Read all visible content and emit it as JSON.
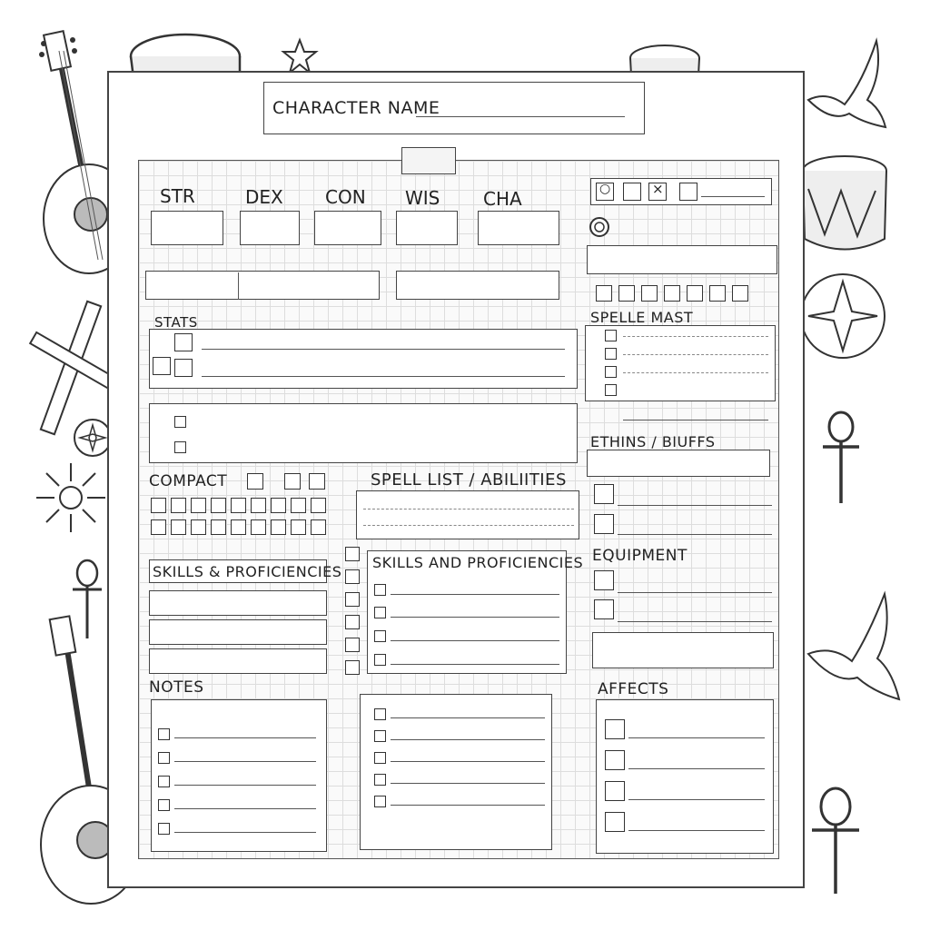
{
  "header": {
    "character_name_label": "CHARACTER NAME"
  },
  "stats": {
    "labels": [
      "STR",
      "DEX",
      "CON",
      "WIS",
      "CHA"
    ]
  },
  "top_right": {
    "check_marks": [
      "○",
      "×"
    ]
  },
  "sections": {
    "stats": "STATS",
    "spell_mast": "SPELLE MAST",
    "ethins_buffs": "ETHINS / BIUFFS",
    "compact": "COMPACT",
    "spell_list": "SPELL LIST / ABILIITIES",
    "skills_left": "SKILLS & PROFICIENCIES",
    "skills_mid": "SKILLS AND PROFICIENCIES",
    "equipment": "EQUIPMENT",
    "notes": "NOTES",
    "affects": "AFFECTS"
  },
  "icons": [
    "lute-icon",
    "drum-icon",
    "star-icon",
    "dove-icon",
    "sun-icon",
    "ankh-icon",
    "flute-icon",
    "compass-star-icon"
  ]
}
